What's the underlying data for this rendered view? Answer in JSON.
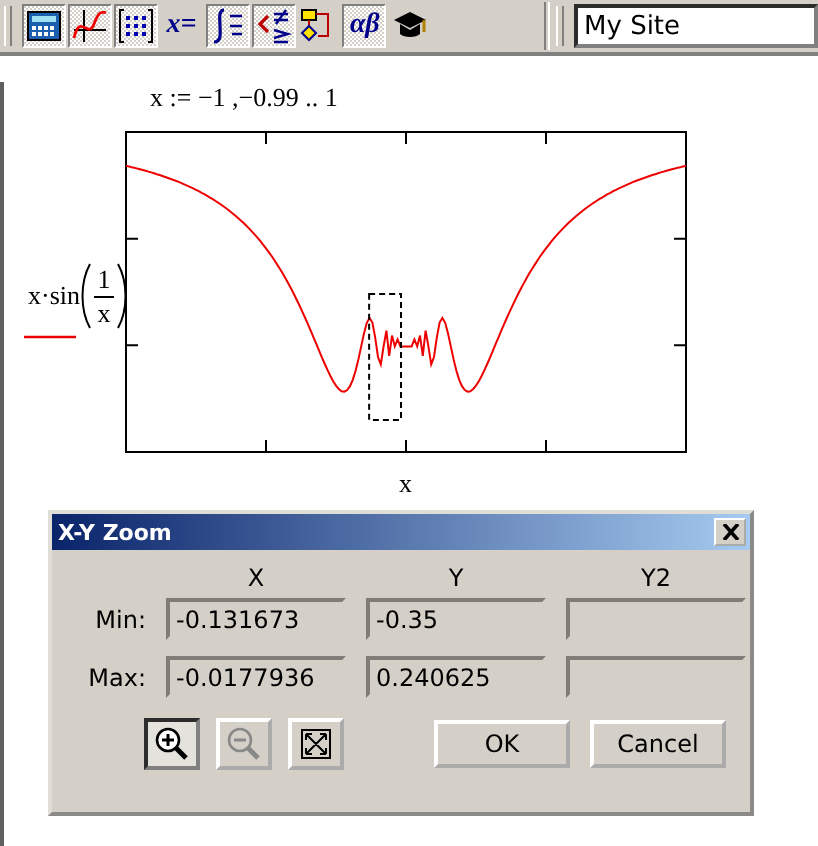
{
  "toolbar": {
    "buttons": [
      {
        "kind": "calculator",
        "pressed": true
      },
      {
        "kind": "graph",
        "pressed": true
      },
      {
        "kind": "matrix",
        "pressed": true
      },
      {
        "kind": "evaluation",
        "label": "x=",
        "pressed": false
      },
      {
        "kind": "calculus",
        "pressed": true
      },
      {
        "kind": "boolean",
        "pressed": true
      },
      {
        "kind": "programming",
        "pressed": false
      },
      {
        "kind": "greek",
        "label": "αβ",
        "pressed": true
      },
      {
        "kind": "symbolic",
        "pressed": false
      }
    ],
    "site_field": {
      "value": "My Site"
    }
  },
  "worksheet": {
    "definition": "x := −1 ,−0.99 .. 1",
    "plot": {
      "trace_prefix": "x·sin",
      "trace_numerator": "1",
      "trace_denominator": "x",
      "x_axis_label": "x"
    }
  },
  "dialog": {
    "title": "X-Y Zoom",
    "columns": [
      "X",
      "Y",
      "Y2"
    ],
    "rows": [
      {
        "label": "Min:",
        "values": [
          "-0.131673",
          "-0.35"
        ]
      },
      {
        "label": "Max:",
        "values": [
          "-0.0177936",
          "0.240625"
        ]
      }
    ],
    "tool_buttons": [
      {
        "kind": "zoom-in",
        "selected": true,
        "disabled": false
      },
      {
        "kind": "zoom-out",
        "selected": false,
        "disabled": true
      },
      {
        "kind": "full-view",
        "selected": false,
        "disabled": false
      }
    ],
    "buttons": [
      "OK",
      "Cancel"
    ]
  }
}
